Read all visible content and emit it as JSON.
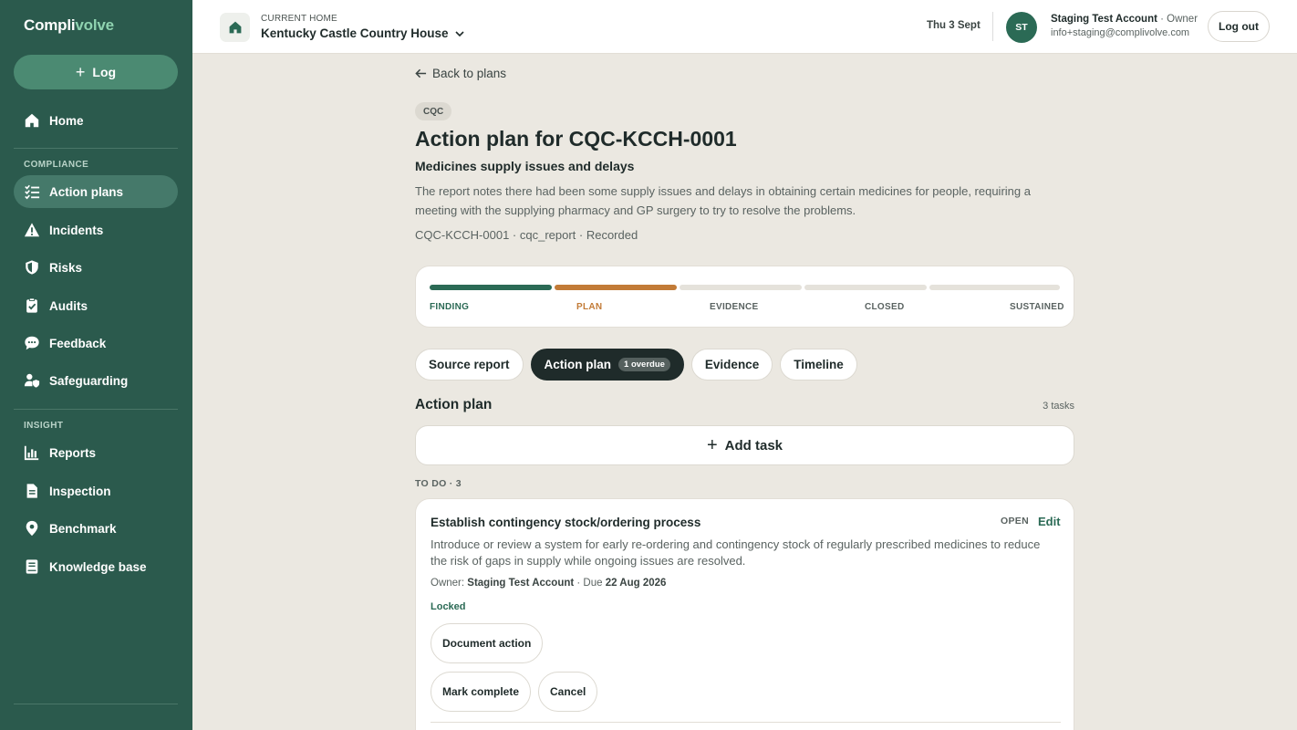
{
  "app": {
    "logo_part1": "Compli",
    "logo_part2": "volve",
    "log_button": "Log"
  },
  "sidebar": {
    "home": "Home",
    "compliance_label": "COMPLIANCE",
    "compliance_items": [
      "Action plans",
      "Incidents",
      "Risks",
      "Audits",
      "Feedback",
      "Safeguarding"
    ],
    "insight_label": "INSIGHT",
    "insight_items": [
      "Reports",
      "Inspection",
      "Benchmark",
      "Knowledge base"
    ],
    "active_item": "Action plans"
  },
  "topbar": {
    "current_home_label": "CURRENT HOME",
    "current_home_name": "Kentucky Castle Country House",
    "date": "Thu 3 Sept",
    "avatar_initials": "ST",
    "account_name": "Staging Test Account",
    "account_role": "· Owner",
    "account_email": "info+staging@complivolve.com",
    "logout": "Log out"
  },
  "main": {
    "back": "Back to plans",
    "tag": "CQC",
    "title": "Action plan for CQC-KCCH-0001",
    "subtitle": "Medicines supply issues and delays",
    "description": "The report notes there had been some supply issues and delays in obtaining certain medicines for people, requiring a meeting with the supplying pharmacy and GP surgery to try to resolve the problems.",
    "meta": "CQC-KCCH-0001 · cqc_report · Recorded",
    "stages": [
      {
        "label": "FINDING",
        "state": "done"
      },
      {
        "label": "PLAN",
        "state": "current"
      },
      {
        "label": "EVIDENCE",
        "state": "pending"
      },
      {
        "label": "CLOSED",
        "state": "pending"
      },
      {
        "label": "SUSTAINED",
        "state": "pending"
      }
    ],
    "colors": {
      "done": "#2b6a55",
      "current": "#c27b37",
      "pending": "#e5e2db"
    },
    "tabs": {
      "source": "Source report",
      "action_plan": "Action plan",
      "overdue_badge": "1 overdue",
      "evidence": "Evidence",
      "timeline": "Timeline"
    },
    "section_title": "Action plan",
    "task_count": "3 tasks",
    "add_task": "Add task",
    "group_label": "TO DO · 3",
    "task": {
      "title": "Establish contingency stock/ordering process",
      "status": "OPEN",
      "edit": "Edit",
      "description": "Introduce or review a system for early re-ordering and contingency stock of regularly prescribed medicines to reduce the risk of gaps in supply while ongoing issues are resolved.",
      "owner_label": "Owner:",
      "owner": "Staging Test Account",
      "due_label": "· Due",
      "due": "22 Aug 2026",
      "locked": "Locked",
      "document_action": "Document action",
      "mark_complete": "Mark complete",
      "cancel": "Cancel"
    }
  }
}
